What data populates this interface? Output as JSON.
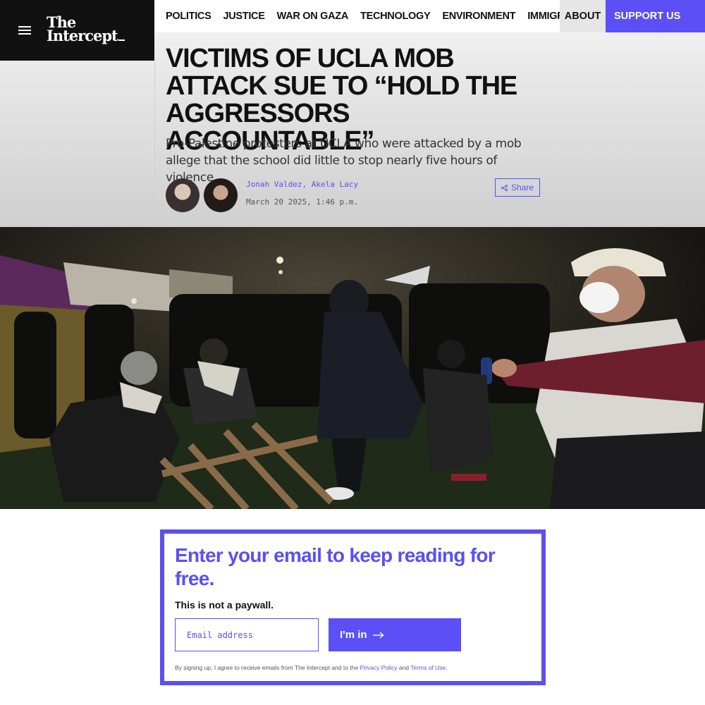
{
  "site": {
    "logo_line1": "The",
    "logo_line2": "Intercept"
  },
  "nav": {
    "items": [
      "POLITICS",
      "JUSTICE",
      "WAR ON GAZA",
      "TECHNOLOGY",
      "ENVIRONMENT",
      "IMMIGRATION"
    ],
    "about": "ABOUT",
    "support": "SUPPORT US"
  },
  "article": {
    "headline": "Victims of UCLA Mob Attack Sue to “Hold the Aggressors Accountable”",
    "dek": "Pro-Palestine protesters at UCLA who were attacked by a mob allege that the school did little to stop nearly five hours of violence.",
    "authors": [
      "Jonah Valdez",
      "Akela Lacy"
    ],
    "author_sep": ", ",
    "date": "March 20 2025, 1:46 p.m.",
    "share_label": "Share"
  },
  "signup": {
    "title": "Enter your email to keep reading for free.",
    "note": "This is not a paywall.",
    "email_placeholder": "Email address",
    "button_label": "I'm in",
    "legal_prefix": "By signing up, I agree to receive emails from The Intercept and to the ",
    "privacy_link": "Privacy Policy",
    "legal_and": " and ",
    "terms_link": "Terms of Use",
    "legal_suffix": "."
  },
  "colors": {
    "accent": "#5b4ff5",
    "logo_bg": "#111111"
  }
}
